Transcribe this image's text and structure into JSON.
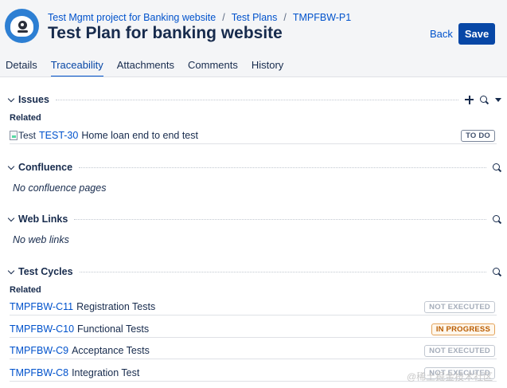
{
  "breadcrumb": {
    "project": "Test Mgmt project for Banking website",
    "section": "Test Plans",
    "key": "TMPFBW-P1"
  },
  "page_title": "Test Plan for banking website",
  "actions": {
    "back": "Back",
    "save": "Save"
  },
  "tabs": [
    {
      "label": "Details",
      "active": false
    },
    {
      "label": "Traceability",
      "active": true
    },
    {
      "label": "Attachments",
      "active": false
    },
    {
      "label": "Comments",
      "active": false
    },
    {
      "label": "History",
      "active": false
    }
  ],
  "issues": {
    "title": "Issues",
    "subheading": "Related",
    "items": [
      {
        "img_alt": "Test",
        "key": "TEST-30",
        "summary": "Home loan end to end test",
        "status": "TO DO"
      }
    ]
  },
  "confluence": {
    "title": "Confluence",
    "empty": "No confluence pages"
  },
  "web_links": {
    "title": "Web Links",
    "empty": "No web links"
  },
  "test_cycles": {
    "title": "Test Cycles",
    "subheading": "Related",
    "items": [
      {
        "key": "TMPFBW-C11",
        "name": "Registration Tests",
        "status": "NOT EXECUTED"
      },
      {
        "key": "TMPFBW-C10",
        "name": "Functional Tests",
        "status": "IN PROGRESS"
      },
      {
        "key": "TMPFBW-C9",
        "name": "Acceptance Tests",
        "status": "NOT EXECUTED"
      },
      {
        "key": "TMPFBW-C8",
        "name": "Integration Test",
        "status": "NOT EXECUTED"
      }
    ]
  },
  "watermark": "@稀土掘金技术社区",
  "colors": {
    "accent": "#0052cc",
    "save_button": "#0747a6",
    "in_progress": "#b95c00"
  }
}
